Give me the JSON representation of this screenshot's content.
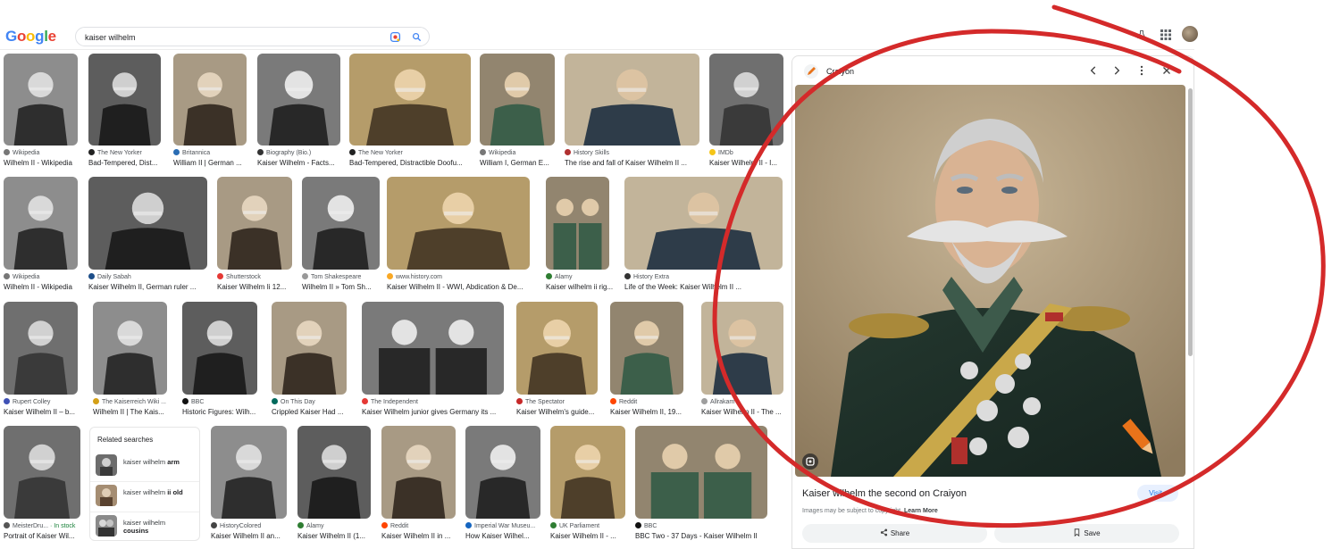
{
  "header": {
    "logo": "Google",
    "search_value": "kaiser wilhelm",
    "lens_icon": "camera-lens-icon",
    "search_icon": "search-icon"
  },
  "rows": [
    [
      {
        "source": "Wikipedia",
        "title": "Wilhelm II - Wikipedia",
        "fav": "#777"
      },
      {
        "source": "The New Yorker",
        "title": "Bad-Tempered, Dist...",
        "fav": "#222"
      },
      {
        "source": "Britannica",
        "title": "William II | German ...",
        "fav": "#2a6db4"
      },
      {
        "source": "Biography (Bio.)",
        "title": "Kaiser Wilhelm - Facts...",
        "fav": "#333"
      },
      {
        "source": "The New Yorker",
        "title": "Bad-Tempered, Distractible Doofu...",
        "fav": "#222"
      },
      {
        "source": "Wikipedia",
        "title": "William I, German E...",
        "fav": "#777"
      },
      {
        "source": "History Skills",
        "title": "The rise and fall of Kaiser Wilhelm II ...",
        "fav": "#b03030"
      },
      {
        "source": "IMDb",
        "title": "Kaiser Wilhelm II - I...",
        "fav": "#f5c518"
      }
    ],
    [
      {
        "source": "Wikipedia",
        "title": "Wilhelm II - Wikipedia",
        "fav": "#777"
      },
      {
        "source": "Daily Sabah",
        "title": "Kaiser Wilhelm II, German ruler ...",
        "fav": "#1d4e89"
      },
      {
        "source": "Shutterstock",
        "title": "Kaiser Wilhelm Ii 12...",
        "fav": "#e53935"
      },
      {
        "source": "Tom Shakespeare",
        "title": "Wilhelm II » Tom Sh...",
        "fav": "#999"
      },
      {
        "source": "www.history.com",
        "title": "Kaiser Wilhelm II - WWI, Abdication & De...",
        "fav": "#f9a825"
      },
      {
        "source": "Alamy",
        "title": "Kaiser wilhelm ii rig...",
        "fav": "#2e7d32"
      },
      {
        "source": "History Extra",
        "title": "Life of the Week: Kaiser Wilhelm II ...",
        "fav": "#333"
      }
    ],
    [
      {
        "source": "Rupert Colley",
        "title": "Kaiser Wilhelm II – b...",
        "fav": "#3f51b5"
      },
      {
        "source": "The Kaiserreich Wiki ...",
        "title": "Wilhelm II | The Kais...",
        "fav": "#d4a017"
      },
      {
        "source": "BBC",
        "title": "Historic Figures: Wilh...",
        "fav": "#111"
      },
      {
        "source": "On This Day",
        "title": "Crippled Kaiser Had ...",
        "fav": "#00695c"
      },
      {
        "source": "The Independent",
        "title": "Kaiser Wilhelm junior gives Germany its ...",
        "fav": "#e53935"
      },
      {
        "source": "The Spectator",
        "title": "Kaiser Wilhelm's guide...",
        "fav": "#c62828"
      },
      {
        "source": "Reddit",
        "title": "Kaiser Wilhelm II, 19...",
        "fav": "#ff4500"
      },
      {
        "source": "Allrakam",
        "title": "Kaiser Wilhelm II - The ...",
        "fav": "#9e9e9e"
      }
    ],
    [
      {
        "source": "MeisterDru...",
        "instock": "· In stock",
        "title": "Portrait of Kaiser Wil...",
        "fav": "#555"
      },
      {
        "source": "HistoryColored",
        "title": "Kaiser Wilhelm II an...",
        "fav": "#444"
      },
      {
        "source": "Alamy",
        "title": "Kaiser Wilhelm II (1...",
        "fav": "#2e7d32"
      },
      {
        "source": "Reddit",
        "title": "Kaiser Wilhelm II in ...",
        "fav": "#ff4500"
      },
      {
        "source": "Imperial War Museu...",
        "title": "How Kaiser Wilhel...",
        "fav": "#1565c0"
      },
      {
        "source": "UK Parliament",
        "title": "Kaiser Wilhelm II - ...",
        "fav": "#2e7d32"
      },
      {
        "source": "BBC",
        "title": "BBC Two - 37 Days - Kaiser Wilhelm II",
        "fav": "#111"
      }
    ]
  ],
  "related": {
    "heading": "Related searches",
    "items": [
      {
        "prefix": "kaiser wilhelm ",
        "bold": "arm"
      },
      {
        "prefix": "kaiser wilhelm ",
        "bold": "ii old"
      },
      {
        "prefix": "kaiser wilhelm ",
        "bold": "cousins"
      }
    ]
  },
  "panel": {
    "source": "Craiyon",
    "title": "Kaiser wilhelm the second on Craiyon",
    "visit_label": "Visit",
    "copyright": "Images may be subject to copyright.",
    "learn_more": "Learn More",
    "share_label": "Share",
    "save_label": "Save"
  },
  "colors": {
    "annotation": "#d42a2a",
    "link": "#1a73e8"
  }
}
